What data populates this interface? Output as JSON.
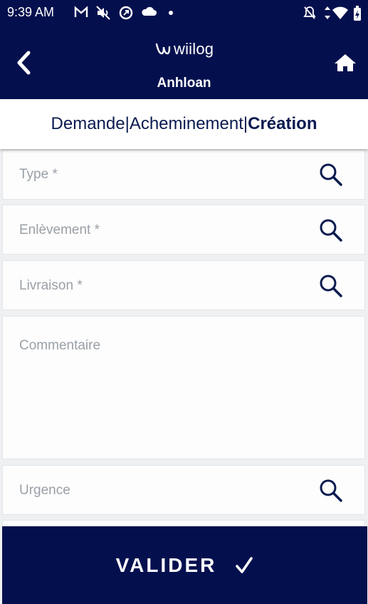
{
  "status_bar": {
    "time": "9:39 AM"
  },
  "header": {
    "brand": "wiilog",
    "title": "Anhloan"
  },
  "stepper": {
    "step1": "Demande",
    "sep": "|",
    "step2": "Acheminement",
    "step3": "Création"
  },
  "form": {
    "type_label": "Type *",
    "pickup_label": "Enlèvement *",
    "delivery_label": "Livraison *",
    "comment_label": "Commentaire",
    "urgency_label": "Urgence"
  },
  "actions": {
    "validate_label": "VALIDER"
  },
  "colors": {
    "primary": "#04104e",
    "placeholder": "#9aa0a8",
    "field_bg": "#fcfdfc"
  }
}
